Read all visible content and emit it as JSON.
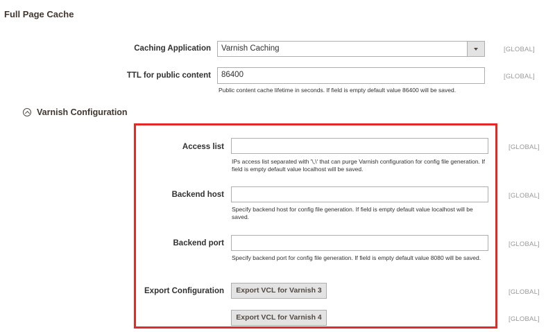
{
  "section": {
    "title": "Full Page Cache"
  },
  "caching_application": {
    "label": "Caching Application",
    "value": "Varnish Caching",
    "scope": "[GLOBAL]"
  },
  "ttl": {
    "label": "TTL for public content",
    "value": "86400",
    "note": "Public content cache lifetime in seconds. If field is empty default value 86400 will be saved.",
    "scope": "[GLOBAL]"
  },
  "varnish": {
    "title": "Varnish Configuration",
    "access_list": {
      "label": "Access list",
      "value": "",
      "note": "IPs access list separated with '\\,\\' that can purge Varnish configuration for config file generation. If field is empty default value localhost will be saved.",
      "scope": "[GLOBAL]"
    },
    "backend_host": {
      "label": "Backend host",
      "value": "",
      "note": "Specify backend host for config file generation. If field is empty default value localhost will be saved.",
      "scope": "[GLOBAL]"
    },
    "backend_port": {
      "label": "Backend port",
      "value": "",
      "note": "Specify backend port for config file generation. If field is empty default value 8080 will be saved.",
      "scope": "[GLOBAL]"
    },
    "export": {
      "label": "Export Configuration",
      "button_v3": "Export VCL for Varnish 3",
      "button_v4": "Export VCL for Varnish 4",
      "scope_v3": "[GLOBAL]",
      "scope_v4": "[GLOBAL]"
    }
  },
  "colors": {
    "highlight_border": "#e02b27",
    "button_bg": "#e3e3e3",
    "scope_text": "#999999"
  },
  "icons": {
    "group_toggle": "chevron-up-circle-icon",
    "select_arrow": "triangle-down-icon"
  }
}
